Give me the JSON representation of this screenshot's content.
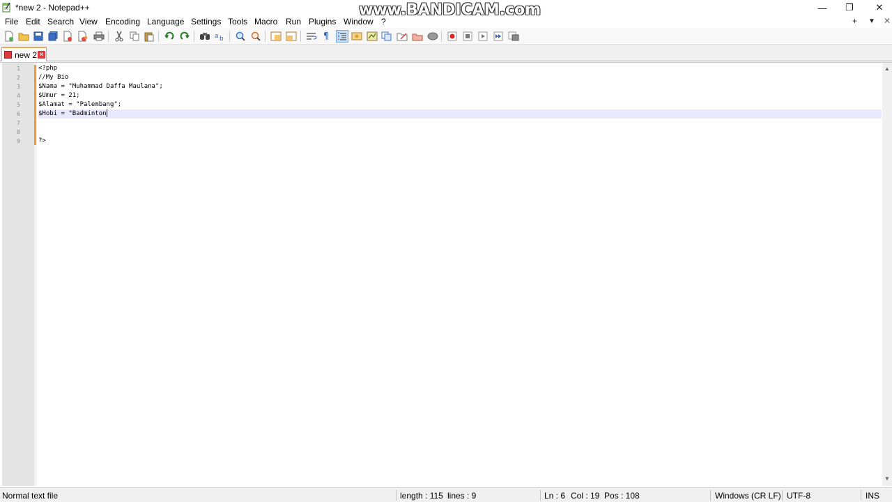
{
  "window": {
    "title": "*new 2 - Notepad++",
    "watermark": "www.BANDICAM.com",
    "controls": {
      "minimize": "—",
      "maximize": "❐",
      "close": "✕"
    }
  },
  "menu": {
    "items": [
      "File",
      "Edit",
      "Search",
      "View",
      "Encoding",
      "Language",
      "Settings",
      "Tools",
      "Macro",
      "Run",
      "Plugins",
      "Window",
      "?"
    ],
    "right": {
      "add": "+",
      "dropdown": "▼",
      "close": "✕"
    }
  },
  "toolbar": {
    "icons": [
      "new-file",
      "open-file",
      "save",
      "save-all",
      "close",
      "close-all",
      "print",
      "cut",
      "copy",
      "paste",
      "undo",
      "redo",
      "find",
      "replace",
      "zoom-in",
      "zoom-out",
      "sync-vertical",
      "sync-horizontal",
      "word-wrap",
      "show-all-chars",
      "indent-guide",
      "language-udl",
      "document-map",
      "function-list",
      "folder-workspace",
      "monitoring",
      "record-macro",
      "stop-recording",
      "playback-macro",
      "run-macro-multiple",
      "save-macro"
    ]
  },
  "tabs": [
    {
      "label": "new 2",
      "close": "✕",
      "state": "modified"
    }
  ],
  "editor": {
    "line_numbers": [
      "1",
      "2",
      "3",
      "4",
      "5",
      "6",
      "7",
      "8",
      "9"
    ],
    "lines": [
      "<?php",
      "//My Bio",
      "$Nama = \"Muhammad Daffa Maulana\";",
      "$Umur = 21;",
      "$Alamat = \"Palembang\";",
      "$Hobi = \"Badminton",
      "",
      "",
      "?>"
    ],
    "current_line": 6
  },
  "scrollbar": {
    "up": "▲",
    "down": "▼"
  },
  "status": {
    "file_type": "Normal text file",
    "length": "length : 115",
    "lines": "lines : 9",
    "ln": "Ln : 6",
    "col": "Col : 19",
    "pos": "Pos : 108",
    "eol": "Windows (CR LF)",
    "encoding": "UTF-8",
    "mode": "INS"
  }
}
